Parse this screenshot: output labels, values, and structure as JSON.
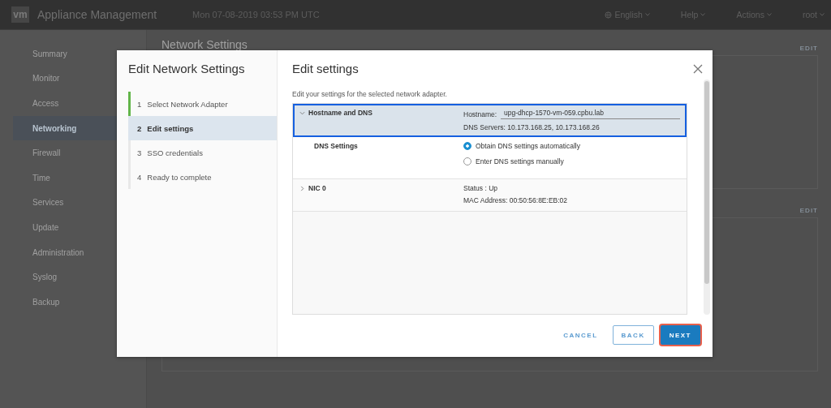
{
  "header": {
    "logo": "vm",
    "title": "Appliance Management",
    "datetime": "Mon 07-08-2019 03:53 PM UTC",
    "menus": [
      {
        "label": "English",
        "kind": "language"
      },
      {
        "label": "Help",
        "kind": "plain"
      },
      {
        "label": "Actions",
        "kind": "plain"
      },
      {
        "label": "root",
        "kind": "plain"
      }
    ]
  },
  "sidebar": {
    "items": [
      {
        "label": "Summary",
        "selected": false
      },
      {
        "label": "Monitor",
        "selected": false
      },
      {
        "label": "Access",
        "selected": false
      },
      {
        "label": "Networking",
        "selected": true
      },
      {
        "label": "Firewall",
        "selected": false
      },
      {
        "label": "Time",
        "selected": false
      },
      {
        "label": "Services",
        "selected": false
      },
      {
        "label": "Update",
        "selected": false
      },
      {
        "label": "Administration",
        "selected": false
      },
      {
        "label": "Syslog",
        "selected": false
      },
      {
        "label": "Backup",
        "selected": false
      }
    ]
  },
  "main": {
    "title": "Network Settings",
    "edit_links": [
      "EDIT",
      "EDIT"
    ]
  },
  "dialog": {
    "title": "Edit Network Settings",
    "steps": [
      {
        "number": "1",
        "label": "Select Network Adapter",
        "selected": false,
        "completed": true
      },
      {
        "number": "2",
        "label": "Edit settings",
        "selected": true,
        "completed": false
      },
      {
        "number": "3",
        "label": "SSO credentials",
        "selected": false,
        "completed": false
      },
      {
        "number": "4",
        "label": "Ready to complete",
        "selected": false,
        "completed": false
      }
    ],
    "panel": {
      "title": "Edit settings",
      "description": "Edit your settings for the selected network adapter.",
      "rows": [
        {
          "kind": "group",
          "label": "Hostname and DNS",
          "expanded": true,
          "selected": true,
          "fields": [
            {
              "kind": "input",
              "label": "Hostname:",
              "value": "upg-dhcp-1570-vm-059.cpbu.lab"
            },
            {
              "kind": "text",
              "text": "DNS Servers: 10.173.168.25, 10.173.168.26"
            }
          ]
        },
        {
          "kind": "radio",
          "label": "DNS Settings",
          "options": [
            {
              "label": "Obtain DNS settings automatically",
              "selected": true
            },
            {
              "label": "Enter DNS settings manually",
              "selected": false
            }
          ]
        },
        {
          "kind": "group",
          "label": "NIC 0",
          "expanded": false,
          "selected": false,
          "fields": [
            {
              "kind": "text",
              "text": "Status : Up"
            },
            {
              "kind": "text",
              "text": "MAC Address: 00:50:56:8E:EB:02"
            }
          ]
        }
      ]
    },
    "buttons": [
      {
        "label": "CANCEL",
        "kind": "flat",
        "highlighted": false
      },
      {
        "label": "BACK",
        "kind": "outline",
        "highlighted": false
      },
      {
        "label": "NEXT",
        "kind": "primary",
        "highlighted": true
      }
    ]
  }
}
